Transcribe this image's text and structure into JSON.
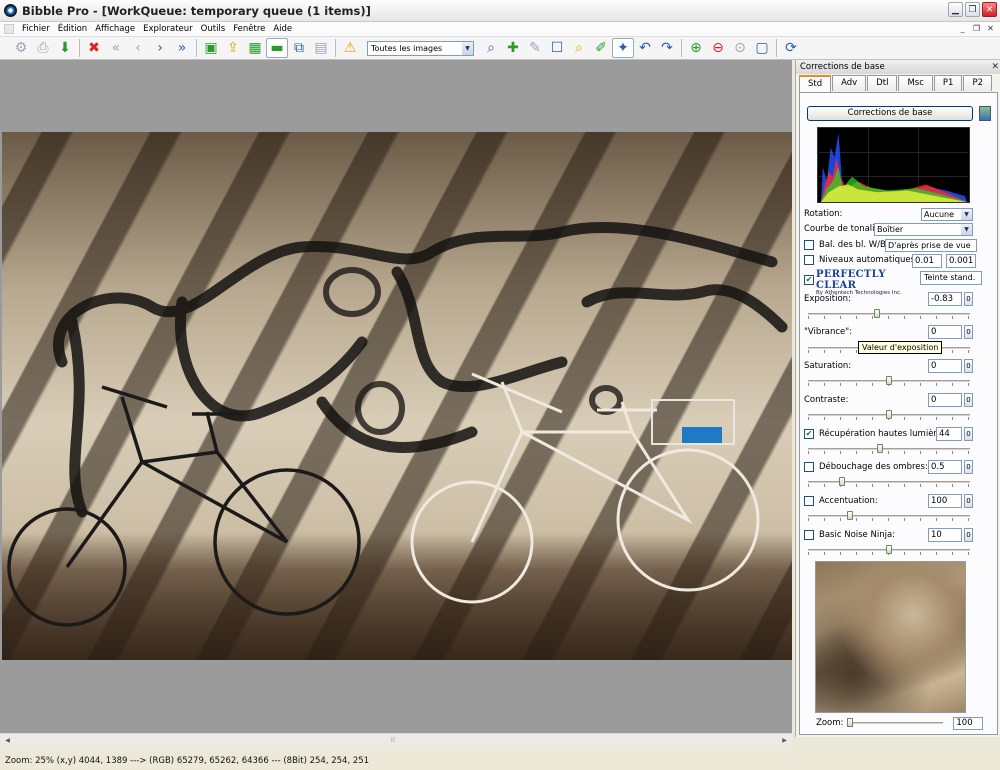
{
  "window": {
    "title": "Bibble Pro - [WorkQueue: temporary queue (1 items)]"
  },
  "menu": [
    "Fichier",
    "Édition",
    "Affichage",
    "Explorateur",
    "Outils",
    "Fenêtre",
    "Aide"
  ],
  "toolbar": {
    "filter_value": "Toutes les images"
  },
  "status": {
    "text": "Zoom:  25% (x,y) 4044, 1389 ---> (RGB) 65279, 65262, 64366 ---  (8Bit) 254, 254, 251"
  },
  "panel": {
    "title": "Corrections de base",
    "tabs": [
      "Std",
      "Adv",
      "Dtl",
      "Msc",
      "P1",
      "P2"
    ],
    "active_tab": "Std",
    "header_button": "Corrections de base",
    "rotation": {
      "label": "Rotation:",
      "value": "Aucune"
    },
    "tone_curve": {
      "label": "Courbe de tonalité:",
      "value": "Boîtier"
    },
    "white_balance": {
      "label": "Bal. des bl. W/B",
      "value": "D'après prise de vue",
      "checked": false
    },
    "auto_levels": {
      "label": "Niveaux automatiques:",
      "low": "0.01",
      "high": "0.001",
      "checked": false
    },
    "perfectly_clear": {
      "logo_main": "PERFECTLY CLEAR",
      "logo_sub": "By Athentech Technologies Inc.",
      "button": "Teinte stand.",
      "checked": true
    },
    "exposure": {
      "label": "Exposition:",
      "value": "-0.83",
      "spin": "0",
      "level": 0.42
    },
    "vibrance": {
      "label": "\"Vibrance\":",
      "value": "0",
      "spin": "0",
      "level": 0.5
    },
    "tooltip": "Valeur d'exposition",
    "saturation": {
      "label": "Saturation:",
      "value": "0",
      "spin": "0",
      "level": 0.5
    },
    "contrast": {
      "label": "Contraste:",
      "value": "0",
      "spin": "0",
      "level": 0.5
    },
    "highlight_recovery": {
      "label": "Récupération hautes lumières:",
      "value": "44",
      "spin": "0",
      "checked": true,
      "level": 0.44
    },
    "fill_shadows": {
      "label": "Débouchage des ombres:",
      "value": "0.5",
      "spin": "0",
      "checked": false,
      "level": 0.2
    },
    "sharpen": {
      "label": "Accentuation:",
      "value": "100",
      "spin": "0",
      "checked": false,
      "level": 0.25
    },
    "noise_ninja": {
      "label": "Basic Noise Ninja:",
      "value": "10",
      "spin": "0",
      "checked": false,
      "level": 0.5
    },
    "zoom": {
      "label": "Zoom:",
      "value": "100",
      "level": 0.0
    }
  },
  "colors": {
    "accent_tab": "#e68b2c",
    "viewer_bg": "#9b9b9c",
    "close_red": "#c22"
  }
}
